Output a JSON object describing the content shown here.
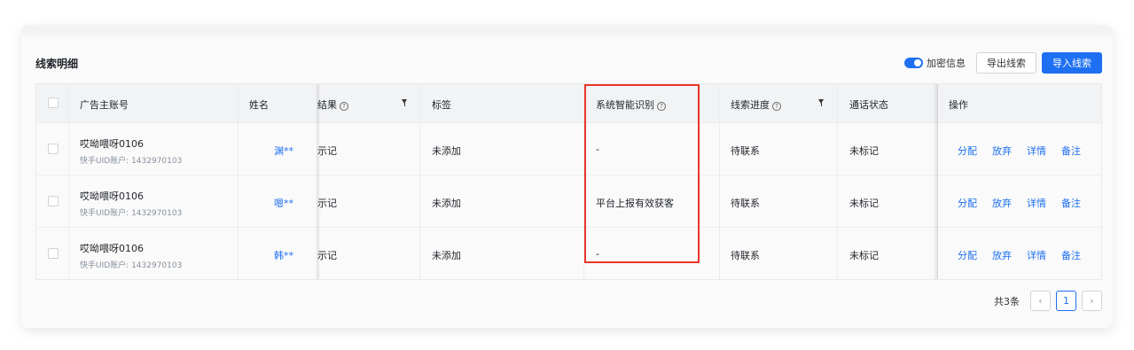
{
  "title": "线索明细",
  "toolbar": {
    "encrypt_label": "加密信息",
    "encrypt_on": true,
    "export_label": "导出线索",
    "import_label": "导入线索"
  },
  "columns": {
    "account": "广告主账号",
    "name": "姓名",
    "result": "结果",
    "tags": "标签",
    "smart": "系统智能识别",
    "progress": "线索进度",
    "call_status": "通话状态",
    "actions": "操作"
  },
  "rows": [
    {
      "account": "哎呦喂呀0106",
      "uid": "快手UID账户: 1432970103",
      "name": "渊**",
      "result": "示记",
      "tags": "未添加",
      "smart": "-",
      "progress": "待联系",
      "call_status": "未标记"
    },
    {
      "account": "哎呦喂呀0106",
      "uid": "快手UID账户: 1432970103",
      "name": "嗯**",
      "result": "示记",
      "tags": "未添加",
      "smart": "平台上报有效获客",
      "progress": "待联系",
      "call_status": "未标记"
    },
    {
      "account": "哎呦喂呀0106",
      "uid": "快手UID账户: 1432970103",
      "name": "韩**",
      "result": "示记",
      "tags": "未添加",
      "smart": "-",
      "progress": "待联系",
      "call_status": "未标记"
    }
  ],
  "row_actions": {
    "assign": "分配",
    "abandon": "放弃",
    "detail": "详情",
    "note": "备注"
  },
  "pagination": {
    "total": "共3条",
    "prev": "‹",
    "current": "1",
    "next": "›"
  },
  "colors": {
    "primary": "#1e6ff1",
    "highlight": "#e8362a"
  }
}
